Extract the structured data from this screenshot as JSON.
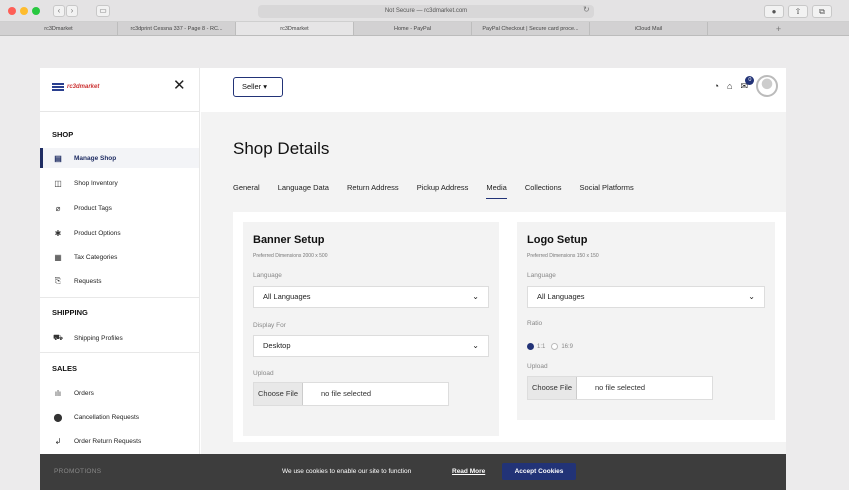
{
  "browser": {
    "url": "Not Secure — rc3dmarket.com",
    "tabs": [
      "rc3Dmarket",
      "rc3dprint Cessna 337 - Page 8 - RC...",
      "rc3Dmarket",
      "Home - PayPal",
      "PayPal Checkout | Secure card proce...",
      "iCloud Mail"
    ],
    "new_tab": "+"
  },
  "sidebar": {
    "logo_text": "rc3dmarket",
    "sections": {
      "shop": "SHOP",
      "shipping": "SHIPPING",
      "sales": "SALES",
      "promotions": "PROMOTIONS"
    },
    "items": [
      {
        "label": "Manage Shop",
        "icon": "shop-icon"
      },
      {
        "label": "Shop Inventory",
        "icon": "box-icon"
      },
      {
        "label": "Product Tags",
        "icon": "tag-icon"
      },
      {
        "label": "Product Options",
        "icon": "gear-icon"
      },
      {
        "label": "Tax Categories",
        "icon": "receipt-icon"
      },
      {
        "label": "Requests",
        "icon": "request-icon"
      },
      {
        "label": "Shipping Profiles",
        "icon": "truck-icon"
      },
      {
        "label": "Orders",
        "icon": "orders-icon"
      },
      {
        "label": "Cancellation Requests",
        "icon": "cancel-icon"
      },
      {
        "label": "Order Return Requests",
        "icon": "return-icon"
      }
    ]
  },
  "header": {
    "seller_label": "Seller",
    "message_count": "0"
  },
  "main": {
    "title": "Shop Details",
    "tabs": [
      "General",
      "Language Data",
      "Return Address",
      "Pickup Address",
      "Media",
      "Collections",
      "Social Platforms"
    ],
    "active_tab": "Media",
    "banner": {
      "title": "Banner Setup",
      "hint": "Preferred Dimensions 2000 x 500",
      "language_label": "Language",
      "language_value": "All Languages",
      "display_label": "Display For",
      "display_value": "Desktop",
      "upload_label": "Upload",
      "choose_file": "Choose File",
      "no_file": "no file selected"
    },
    "logo": {
      "title": "Logo Setup",
      "hint": "Preferred Dimensions 150 x 150",
      "language_label": "Language",
      "language_value": "All Languages",
      "ratio_label": "Ratio",
      "ratio_1": "1:1",
      "ratio_2": "16:9",
      "upload_label": "Upload",
      "choose_file": "Choose File",
      "no_file": "no file selected"
    }
  },
  "cookie": {
    "text": "We use cookies to enable our site to function",
    "read_more": "Read More",
    "accept": "Accept Cookies"
  },
  "colors": {
    "accent": "#223377",
    "cookie_bg": "#3d3d3d"
  }
}
